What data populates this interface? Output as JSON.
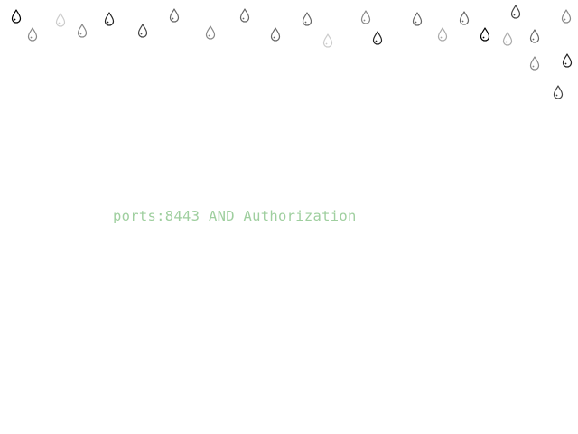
{
  "screen": {
    "query_text": "ports:8443 AND Authorization",
    "query_color": "#9fcf9f",
    "background": "#ffffff"
  },
  "decoration": {
    "icon": "raindrop-icon",
    "count": 30,
    "shades": [
      "#000000",
      "#222222",
      "#444444",
      "#666666",
      "#888888",
      "#aaaaaa",
      "#cccccc"
    ]
  }
}
